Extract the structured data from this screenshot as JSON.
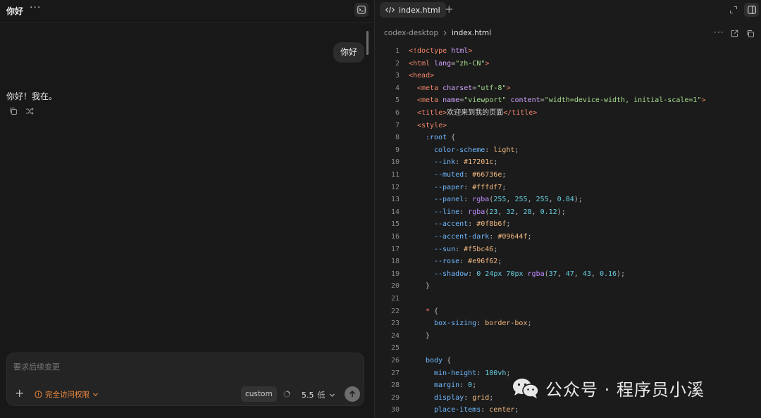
{
  "chat": {
    "title": "你好",
    "user_message": "你好",
    "assistant_message": "你好！我在。"
  },
  "composer": {
    "placeholder": "要求后续变更",
    "permission_label": "完全访问权限",
    "custom_label": "custom",
    "model_version": "5.5",
    "reasoning_level": "低"
  },
  "editor": {
    "tab_label": "index.html",
    "breadcrumb": [
      "codex-desktop",
      "index.html"
    ],
    "lines": [
      {
        "n": "1"
      },
      {
        "n": "2"
      },
      {
        "n": "3"
      },
      {
        "n": "4"
      },
      {
        "n": "5"
      },
      {
        "n": "6"
      },
      {
        "n": "7"
      },
      {
        "n": "8"
      },
      {
        "n": "9"
      },
      {
        "n": "10"
      },
      {
        "n": "11"
      },
      {
        "n": "12"
      },
      {
        "n": "13"
      },
      {
        "n": "14"
      },
      {
        "n": "15"
      },
      {
        "n": "16"
      },
      {
        "n": "17"
      },
      {
        "n": "18"
      },
      {
        "n": "19"
      },
      {
        "n": "20"
      },
      {
        "n": "21"
      },
      {
        "n": "22"
      },
      {
        "n": "23"
      },
      {
        "n": "24"
      },
      {
        "n": "25"
      },
      {
        "n": "26"
      },
      {
        "n": "27"
      },
      {
        "n": "28"
      },
      {
        "n": "29"
      },
      {
        "n": "30"
      }
    ],
    "code": [
      [
        "<!doctype ",
        "html",
        ">"
      ],
      [
        "<html ",
        "lang",
        "=",
        "\"zh-CN\"",
        ">"
      ],
      [
        "<head>"
      ],
      [
        "<meta ",
        "charset",
        "=",
        "\"utf-8\"",
        ">"
      ],
      [
        "<meta ",
        "name",
        "=",
        "\"viewport\"",
        " ",
        "content",
        "=",
        "\"width=device-width, initial-scale=1\"",
        ">"
      ],
      [
        "<title>",
        "欢迎来到我的页面",
        "</title>"
      ],
      [
        "<style>"
      ],
      [
        ":root",
        " {"
      ],
      [
        "color-scheme",
        ": ",
        "light",
        ";"
      ],
      [
        "--ink",
        ": ",
        "#17201c",
        ";"
      ],
      [
        "--muted",
        ": ",
        "#66736e",
        ";"
      ],
      [
        "--paper",
        ": ",
        "#fffdf7",
        ";"
      ],
      [
        "--panel",
        ": ",
        "rgba",
        "(",
        "255",
        ", ",
        "255",
        ", ",
        "255",
        ", ",
        "0.84",
        ");"
      ],
      [
        "--line",
        ": ",
        "rgba",
        "(",
        "23",
        ", ",
        "32",
        ", ",
        "28",
        ", ",
        "0.12",
        ");"
      ],
      [
        "--accent",
        ": ",
        "#0f8b6f",
        ";"
      ],
      [
        "--accent-dark",
        ": ",
        "#09644f",
        ";"
      ],
      [
        "--sun",
        ": ",
        "#f5bc46",
        ";"
      ],
      [
        "--rose",
        ": ",
        "#e96f62",
        ";"
      ],
      [
        "--shadow",
        ": ",
        "0",
        " ",
        "24px",
        " ",
        "70px",
        " ",
        "rgba",
        "(",
        "37",
        ", ",
        "47",
        ", ",
        "43",
        ", ",
        "0.16",
        ");"
      ],
      [
        "}"
      ],
      [
        ""
      ],
      [
        "*",
        " {"
      ],
      [
        "box-sizing",
        ": ",
        "border-box",
        ";"
      ],
      [
        "}"
      ],
      [
        ""
      ],
      [
        "body",
        " {"
      ],
      [
        "min-height",
        ": ",
        "100vh",
        ";"
      ],
      [
        "margin",
        ": ",
        "0",
        ";"
      ],
      [
        "display",
        ": ",
        "grid",
        ";"
      ],
      [
        "place-items",
        ": ",
        "center",
        ";"
      ]
    ]
  },
  "watermark": {
    "text": "公众号 · 程序员小溪"
  }
}
